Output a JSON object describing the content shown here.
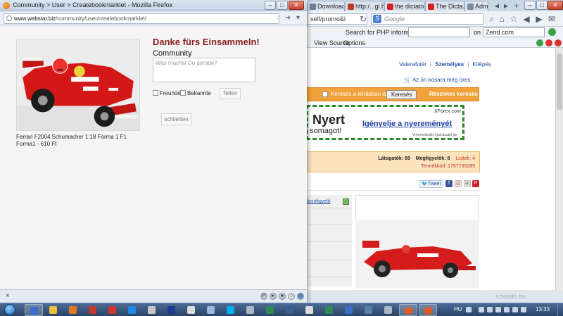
{
  "background_browser": {
    "tabs": [
      {
        "label": "Download ..."
      },
      {
        "label": "http:/...gi.hu/"
      },
      {
        "label": "the dictator ..."
      },
      {
        "label": "The Dicta..."
      },
      {
        "label": "Admi"
      }
    ],
    "url_text": "self/promo&l",
    "search_engine_letter": "S",
    "search_placeholder": "Google",
    "zend_label": "Search for PHP information:",
    "zend_on": "on",
    "zend_select": "Zend.com",
    "view_source": "View Source",
    "options": "Options",
    "user_links": [
      "Vaterafutár",
      "Személyes",
      "Kilépés"
    ],
    "cart_text": "Az ön kosara még üres.",
    "search_desc_label": "Keresés a leírásban is",
    "search_button": "Keresés",
    "detailed_search": "Részletes keresés",
    "ad": {
      "headline": "Nyert",
      "sub": "somagot!",
      "brand": "XForex.com",
      "cta": "Igényelje a nyereményét",
      "fine": "*A kereskedés kockázatot jár"
    },
    "stats": {
      "visitors": "Látogatók: 89",
      "watchers": "Megfigyelők: 8",
      "bids": "Licitek: 4",
      "product_code": "Termékkód: 1797739289"
    },
    "tweet_label": "Tweet",
    "akcio_link": "akciófigyelő",
    "watermark": "szwedo.hu"
  },
  "firefox_window": {
    "title": "Community > User > Createbookmarklet - Mozilla Firefox",
    "url_host": "www.webstar.biz",
    "url_path": "/community/user/createbookmarklet/",
    "heading": "Danke fürs Einsammeln!",
    "community_label": "Community",
    "status_placeholder": "Was machst Du gerade?",
    "checkbox_friends": "Freunde",
    "checkbox_acquaintances": "Bekannte",
    "share_button": "Teilen",
    "close_button": "schließen",
    "product_caption": "Ferrari F2004 Schumacher 1:18 Forma 1 F1 Forma1 - 610 Ft",
    "statusbar_close": "×"
  },
  "taskbar": {
    "language": "HU",
    "clock": "13:33"
  },
  "colors": {
    "heading": "#8a1e1e",
    "orange_bar": "#f2a23a",
    "stats_bg": "#fbe3bd",
    "ad_border": "#2a8a2a",
    "link_blue": "#1d4fa5"
  },
  "icons": [
    "firefox-icon",
    "star-icon",
    "globe-icon",
    "back-icon",
    "reload-icon",
    "home-icon",
    "cart-icon",
    "twitter-icon",
    "facebook-icon",
    "email-icon",
    "print-icon",
    "pinterest-icon",
    "windows-start-icon",
    "close-icon"
  ]
}
